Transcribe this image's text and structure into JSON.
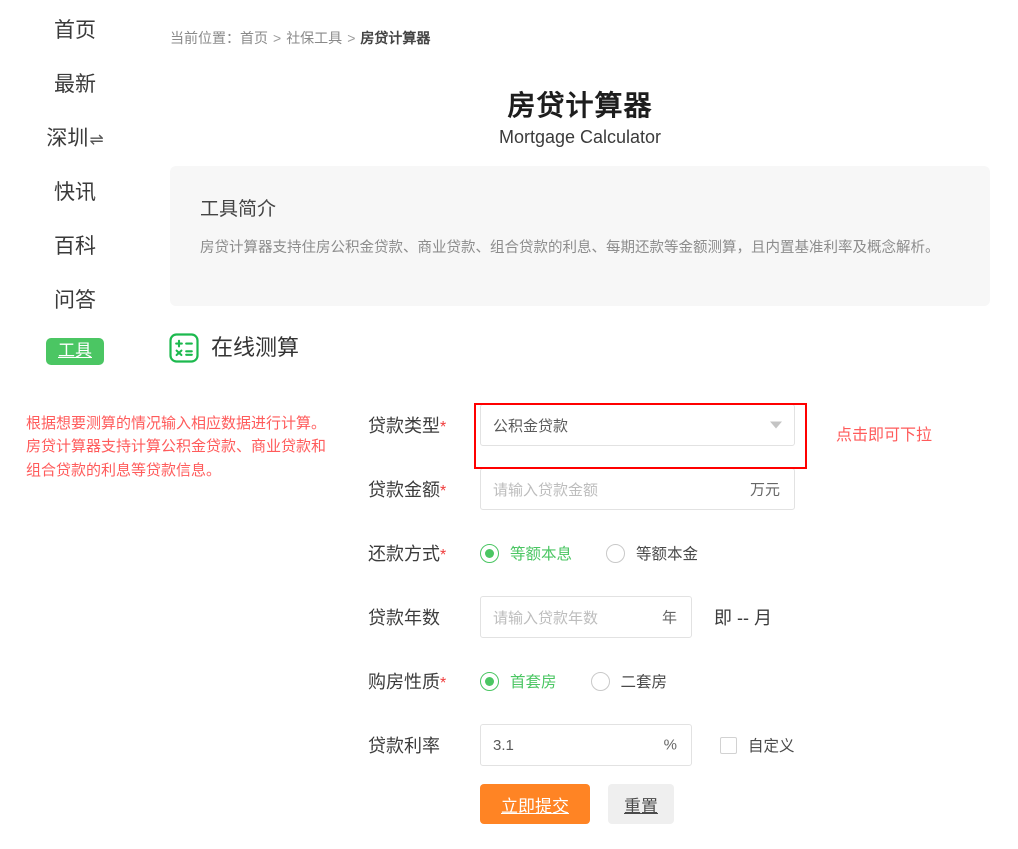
{
  "sidebar": {
    "items": [
      {
        "label": "首页",
        "type": "link",
        "icon": ""
      },
      {
        "label": "最新",
        "type": "link",
        "icon": ""
      },
      {
        "label": "深圳",
        "type": "link",
        "icon": "swap-arrows-icon",
        "glyph": "⇌"
      },
      {
        "label": "快讯",
        "type": "link",
        "icon": ""
      },
      {
        "label": "百科",
        "type": "link",
        "icon": ""
      },
      {
        "label": "问答",
        "type": "link",
        "icon": ""
      }
    ],
    "badge": {
      "label": "工具",
      "color": "#4bc663"
    }
  },
  "breadcrumb": {
    "label": "当前位置：",
    "items": [
      "首页",
      "社保工具",
      "房贷计算器"
    ],
    "separator": ">"
  },
  "header": {
    "title_cn": "房贷计算器",
    "title_en": "Mortgage Calculator"
  },
  "intro": {
    "title": "工具简介",
    "text": "房贷计算器支持住房公积金贷款、商业贷款、组合贷款的利息、每期还款等金额测算，且内置基准利率及概念解析。"
  },
  "section": {
    "icon": "calculator-icon",
    "title": "在线测算"
  },
  "annotations": {
    "left": "根据想要测算的情况输入相应数据进行计算。\n房贷计算器支持计算公积金贷款、商业贷款和组合贷款的利息等贷款信息。",
    "right": "点击即可下拉",
    "color": "#ff5b5b"
  },
  "form": {
    "loan_type": {
      "label": "贷款类型",
      "required": "*",
      "value": "公积金贷款",
      "icon": "chevron-down-icon",
      "highlighted": true
    },
    "loan_amount": {
      "label": "贷款金额",
      "required": "*",
      "value": "",
      "placeholder": "请输入贷款金额",
      "suffix": "万元"
    },
    "repayment_method": {
      "label": "还款方式",
      "required": "*",
      "options": [
        "等额本息",
        "等额本金"
      ],
      "selected": "等额本息"
    },
    "loan_years": {
      "label": "贷款年数",
      "required": "",
      "value": "",
      "placeholder": "请输入贷款年数",
      "suffix": "年",
      "months_note": "即 -- 月"
    },
    "property_type": {
      "label": "购房性质",
      "required": "*",
      "options": [
        "首套房",
        "二套房"
      ],
      "selected": "首套房"
    },
    "loan_rate": {
      "label": "贷款利率",
      "required": "",
      "value": "3.1",
      "suffix": "%",
      "custom_label": "自定义",
      "custom_checked": false
    },
    "buttons": {
      "submit": "立即提交",
      "reset": "重置"
    }
  },
  "colors": {
    "accent_green": "#4bc663",
    "submit_orange": "#ff8424",
    "required_red": "#f03c3c",
    "highlight_red": "#ff0000"
  }
}
